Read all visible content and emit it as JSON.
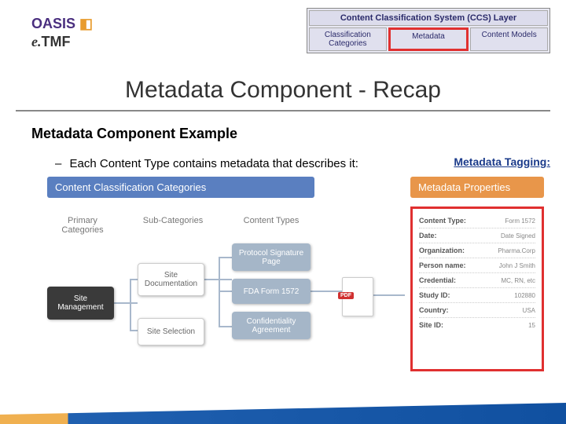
{
  "logos": {
    "oasis": "OASIS",
    "etmf_prefix": "e.",
    "etmf_main": "TMF"
  },
  "ccs": {
    "title": "Content Classification System (CCS) Layer",
    "cells": [
      "Classification Categories",
      "Metadata",
      "Content Models"
    ]
  },
  "title": "Metadata Component - Recap",
  "subtitle": "Metadata Component Example",
  "bullet": "Each Content Type contains metadata that describes it:",
  "tagging_label": "Metadata Tagging:",
  "diagram": {
    "ccc_banner": "Content Classification Categories",
    "mp_banner": "Metadata Properties",
    "col_headers": [
      "Primary Categories",
      "Sub-Categories",
      "Content Types"
    ],
    "site_mgmt": "Site Management",
    "sub_doc": "Site Documentation",
    "sub_sel": "Site Selection",
    "ct1": "Protocol Signature Page",
    "ct2": "FDA Form 1572",
    "ct3": "Confidentiality Agreement",
    "pdf": "PDF"
  },
  "metadata": [
    {
      "label": "Content Type:",
      "value": "Form 1572"
    },
    {
      "label": "Date:",
      "value": "Date Signed"
    },
    {
      "label": "Organization:",
      "value": "Pharma.Corp"
    },
    {
      "label": "Person name:",
      "value": "John J Smith"
    },
    {
      "label": "Credential:",
      "value": "MC, RN, etc"
    },
    {
      "label": "Study ID:",
      "value": "102880"
    },
    {
      "label": "Country:",
      "value": "USA"
    },
    {
      "label": "Site ID:",
      "value": "15"
    }
  ]
}
